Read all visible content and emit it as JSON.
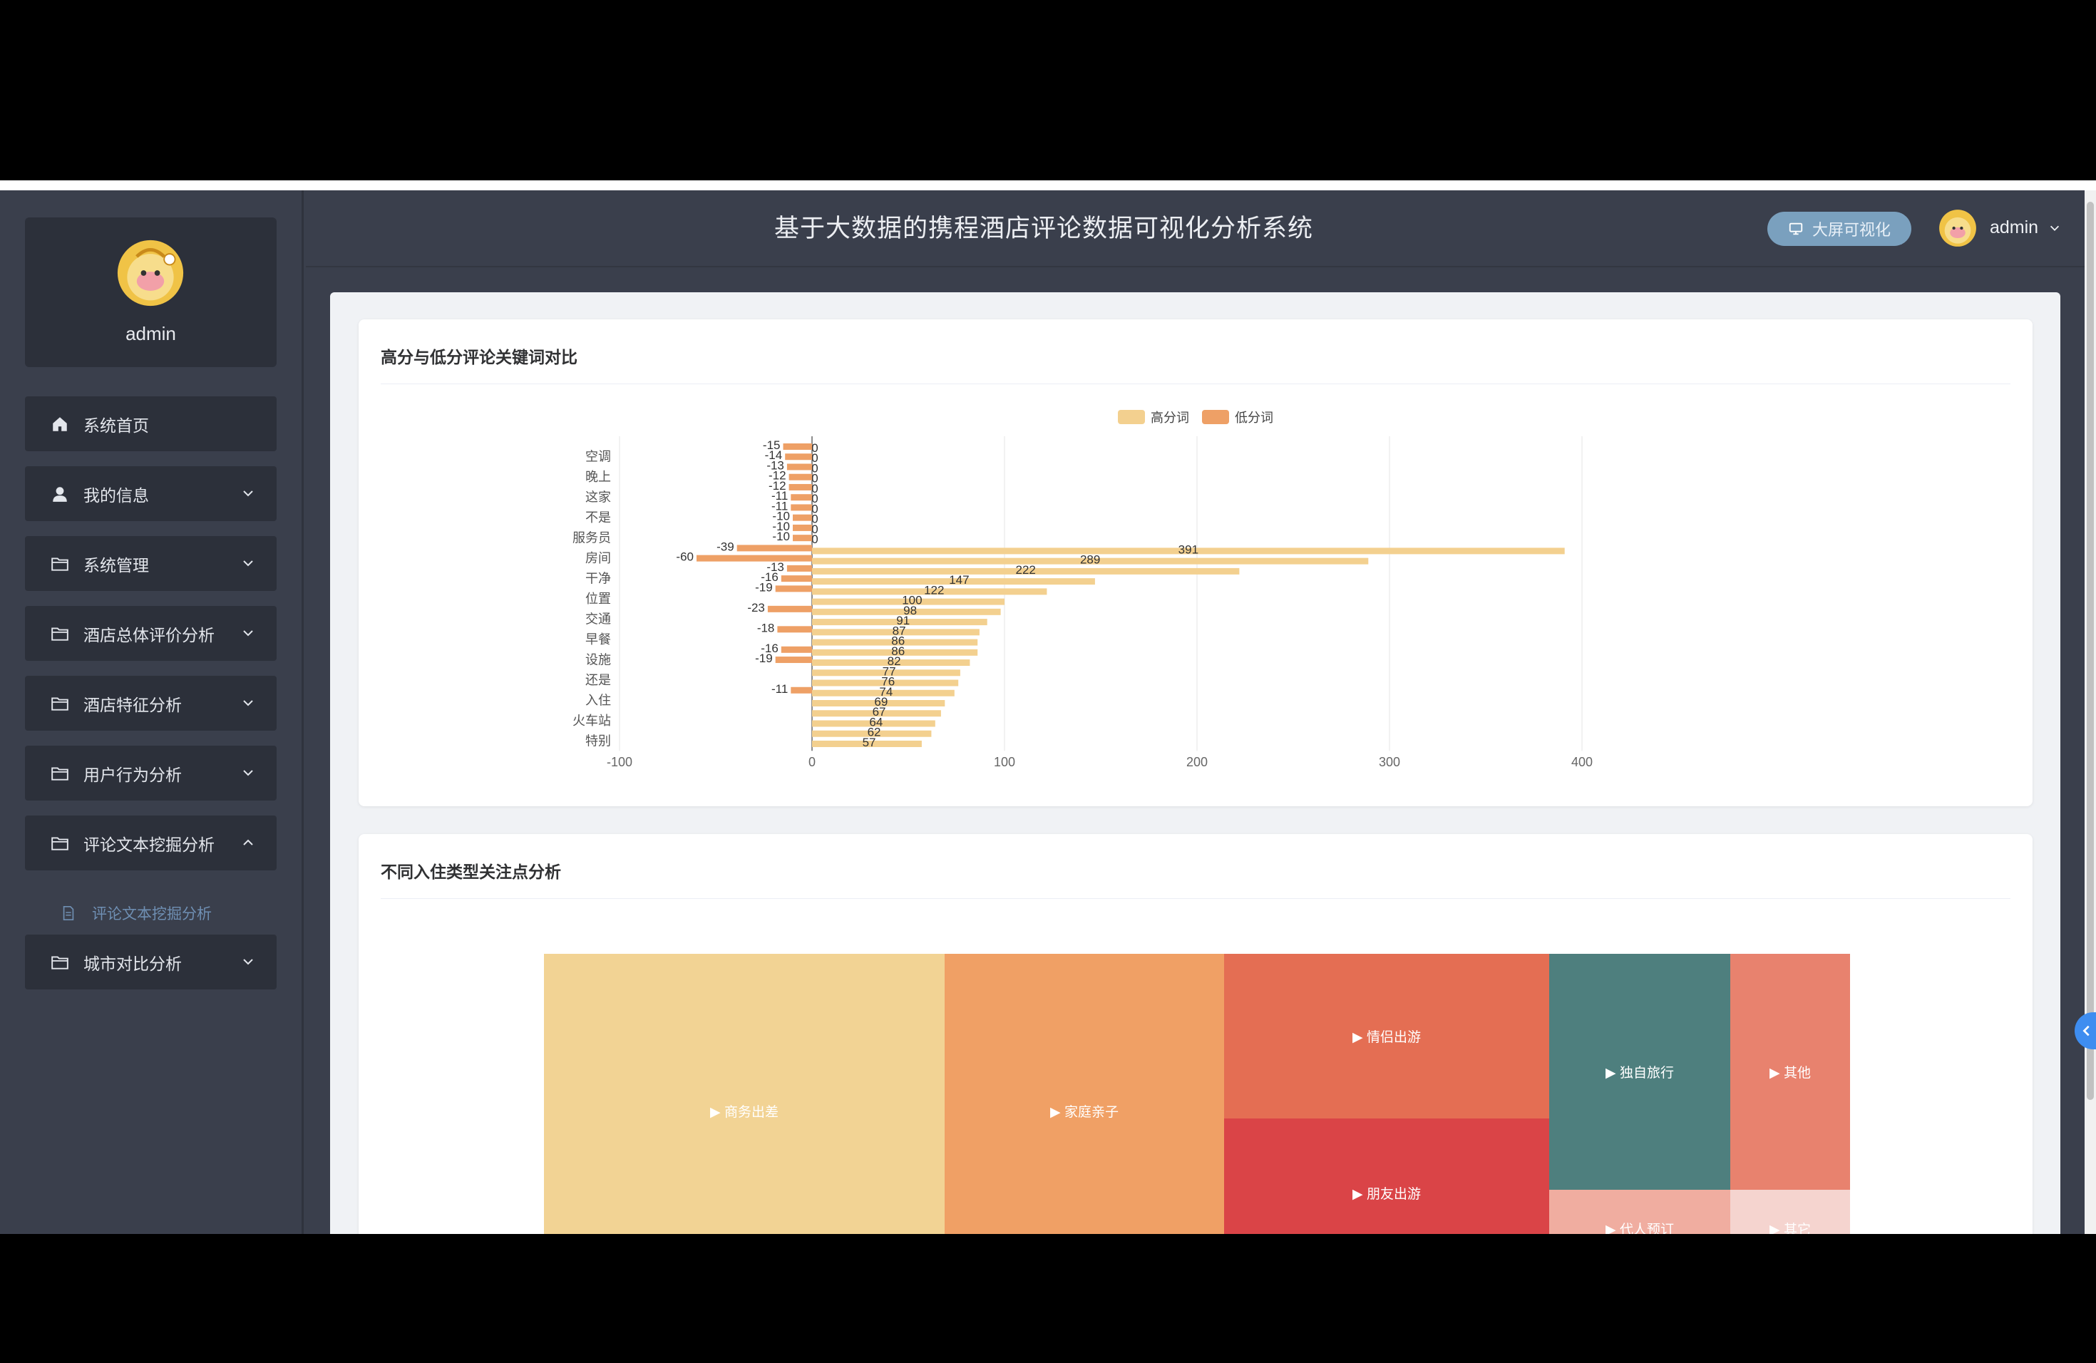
{
  "sidebar": {
    "username": "admin",
    "menu": [
      {
        "label": "系统首页",
        "icon": "home-icon",
        "expandable": false
      },
      {
        "label": "我的信息",
        "icon": "user-icon",
        "expandable": true
      },
      {
        "label": "系统管理",
        "icon": "folder-icon",
        "expandable": true
      },
      {
        "label": "酒店总体评价分析",
        "icon": "folder-icon",
        "expandable": true
      },
      {
        "label": "酒店特征分析",
        "icon": "folder-icon",
        "expandable": true
      },
      {
        "label": "用户行为分析",
        "icon": "folder-icon",
        "expandable": true
      },
      {
        "label": "评论文本挖掘分析",
        "icon": "folder-icon",
        "expandable": true,
        "expanded": true
      },
      {
        "label": "城市对比分析",
        "icon": "folder-icon",
        "expandable": true
      }
    ],
    "submenu_active": "评论文本挖掘分析"
  },
  "header": {
    "title": "基于大数据的携程酒店评论数据可视化分析系统",
    "screen_button": "大屏可视化",
    "user": "admin"
  },
  "colors": {
    "high": "#f3d08f",
    "low": "#eea066",
    "accent": "#3e8df0"
  },
  "card1": {
    "title": "高分与低分评论关键词对比"
  },
  "card2": {
    "title": "不同入住类型关注点分析"
  },
  "chart_data": [
    {
      "type": "bar",
      "orientation": "horizontal",
      "title": "高分与低分评论关键词对比",
      "legend": [
        "高分词",
        "低分词"
      ],
      "legend_position": "top-center",
      "xlim": [
        -100,
        400
      ],
      "x_ticks": [
        -100,
        0,
        100,
        200,
        300,
        400
      ],
      "grid": true,
      "y_tick_labels": [
        "空调",
        "晚上",
        "这家",
        "不是",
        "服务员",
        "房间",
        "干净",
        "位置",
        "交通",
        "早餐",
        "设施",
        "还是",
        "入住",
        "火车站",
        "特别"
      ],
      "series": [
        {
          "name": "高分词",
          "values": [
            0,
            0,
            0,
            0,
            0,
            0,
            0,
            0,
            0,
            0,
            391,
            289,
            222,
            147,
            122,
            100,
            98,
            91,
            87,
            86,
            86,
            82,
            77,
            76,
            74,
            69,
            67,
            64,
            62,
            57
          ]
        },
        {
          "name": "低分词",
          "values": [
            -15,
            -14,
            -13,
            -12,
            -12,
            -11,
            -11,
            -10,
            -10,
            -10,
            -39,
            -60,
            -13,
            -16,
            -19,
            0,
            -23,
            0,
            -18,
            0,
            -16,
            -19,
            0,
            0,
            -11,
            0,
            0,
            0,
            0,
            0
          ]
        }
      ],
      "bar_end_labels": {
        "high": [
          0,
          0,
          0,
          0,
          0,
          0,
          0,
          0,
          0,
          0,
          391,
          289,
          222,
          147,
          122,
          100,
          98,
          91,
          87,
          86,
          86,
          82,
          77,
          76,
          74,
          69,
          67,
          64,
          62,
          57
        ],
        "low": [
          -15,
          -14,
          -13,
          -12,
          -12,
          -11,
          -11,
          -10,
          -10,
          -10,
          -39,
          -60,
          -13,
          -16,
          -19,
          0,
          -23,
          0,
          -18,
          0,
          -16,
          -19,
          0,
          0,
          -11,
          0,
          0,
          0,
          0,
          0
        ]
      }
    },
    {
      "type": "treemap",
      "title": "不同入住类型关注点分析",
      "nodes": [
        {
          "name": "▶ 商务出差",
          "color": "#f2d394"
        },
        {
          "name": "▶ 家庭亲子",
          "color": "#f0a065"
        },
        {
          "name": "▶ 情侣出游",
          "color": "#e46e53"
        },
        {
          "name": "▶ 朋友出游",
          "color": "#da4447"
        },
        {
          "name": "▶ 独自旅行",
          "color": "#4e7f7e"
        },
        {
          "name": "▶ 其他",
          "color": "#e8826e"
        },
        {
          "name": "▶ 代人预订",
          "color": "#f0ada0"
        },
        {
          "name": "▶ 其它",
          "color": "#f5d4cf"
        }
      ]
    }
  ]
}
